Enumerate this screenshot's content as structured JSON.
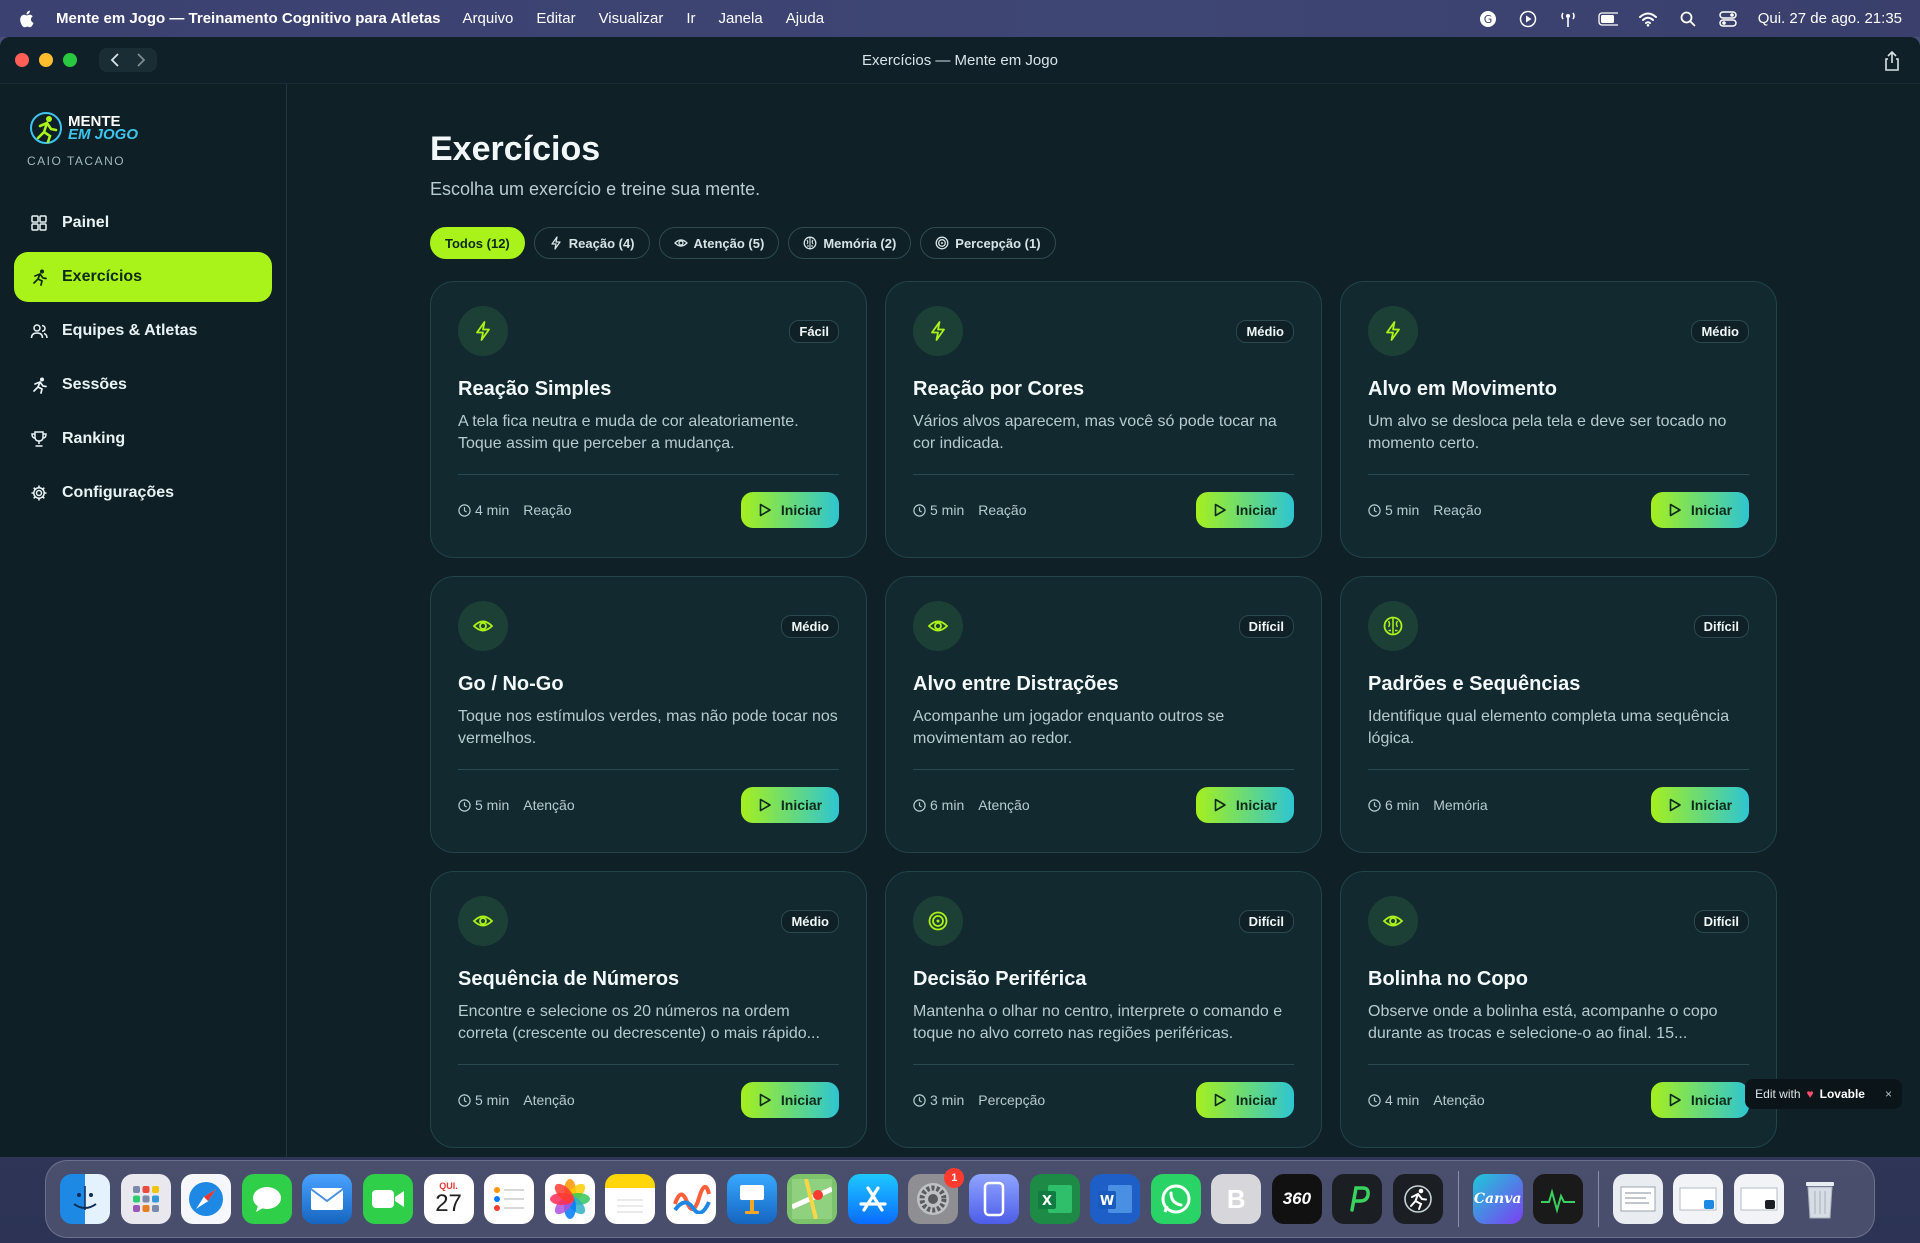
{
  "menubar": {
    "app_name": "Mente em Jogo — Treinamento Cognitivo para Atletas",
    "menus": [
      "Arquivo",
      "Editar",
      "Visualizar",
      "Ir",
      "Janela",
      "Ajuda"
    ],
    "clock": "Qui. 27 de ago.  21:35"
  },
  "window": {
    "title": "Exercícios — Mente em Jogo"
  },
  "sidebar": {
    "brand_line1": "MENTE",
    "brand_line2": "EM JOGO",
    "user": "CAIO TACANO",
    "items": [
      {
        "label": "Painel",
        "icon": "dashboard-icon"
      },
      {
        "label": "Exercícios",
        "icon": "exercises-icon",
        "active": true
      },
      {
        "label": "Equipes & Atletas",
        "icon": "users-icon"
      },
      {
        "label": "Sessões",
        "icon": "sessions-icon"
      },
      {
        "label": "Ranking",
        "icon": "trophy-icon"
      },
      {
        "label": "Configurações",
        "icon": "gear-icon"
      }
    ]
  },
  "main": {
    "title": "Exercícios",
    "subtitle": "Escolha um exercício e treine sua mente.",
    "filters": [
      {
        "label": "Todos (12)",
        "active": true
      },
      {
        "label": "Reação (4)",
        "icon": "bolt-icon"
      },
      {
        "label": "Atenção (5)",
        "icon": "eye-icon"
      },
      {
        "label": "Memória (2)",
        "icon": "brain-icon"
      },
      {
        "label": "Percepção (1)",
        "icon": "target-icon"
      }
    ],
    "start_label": "Iniciar",
    "cards": [
      {
        "title": "Reação Simples",
        "desc": "A tela fica neutra e muda de cor aleatoriamente. Toque assim que perceber a mudança.",
        "level": "Fácil",
        "time": "4 min",
        "category": "Reação",
        "icon": "bolt-icon"
      },
      {
        "title": "Reação por Cores",
        "desc": "Vários alvos aparecem, mas você só pode tocar na cor indicada.",
        "level": "Médio",
        "time": "5 min",
        "category": "Reação",
        "icon": "bolt-icon"
      },
      {
        "title": "Alvo em Movimento",
        "desc": "Um alvo se desloca pela tela e deve ser tocado no momento certo.",
        "level": "Médio",
        "time": "5 min",
        "category": "Reação",
        "icon": "bolt-icon"
      },
      {
        "title": "Go / No-Go",
        "desc": "Toque nos estímulos verdes, mas não pode tocar nos vermelhos.",
        "level": "Médio",
        "time": "5 min",
        "category": "Atenção",
        "icon": "eye-icon"
      },
      {
        "title": "Alvo entre Distrações",
        "desc": "Acompanhe um jogador enquanto outros se movimentam ao redor.",
        "level": "Difícil",
        "time": "6 min",
        "category": "Atenção",
        "icon": "eye-icon"
      },
      {
        "title": "Padrões e Sequências",
        "desc": "Identifique qual elemento completa uma sequência lógica.",
        "level": "Difícil",
        "time": "6 min",
        "category": "Memória",
        "icon": "brain-icon"
      },
      {
        "title": "Sequência de Números",
        "desc": "Encontre e selecione os 20 números na ordem correta (crescente ou decrescente) o mais rápido...",
        "level": "Médio",
        "time": "5 min",
        "category": "Atenção",
        "icon": "eye-icon"
      },
      {
        "title": "Decisão Periférica",
        "desc": "Mantenha o olhar no centro, interprete o comando e toque no alvo correto nas regiões periféricas.",
        "level": "Difícil",
        "time": "3 min",
        "category": "Percepção",
        "icon": "target-icon"
      },
      {
        "title": "Bolinha no Copo",
        "desc": "Observe onde a bolinha está, acompanhe o copo durante as trocas e selecione-o ao final. 15...",
        "level": "Difícil",
        "time": "4 min",
        "category": "Atenção",
        "icon": "eye-icon"
      }
    ]
  },
  "lovable": {
    "prefix": "Edit with",
    "brand": "Lovable",
    "close": "×"
  },
  "dock": {
    "calendar_month": "QUI.",
    "calendar_day": "27",
    "settings_badge": "1",
    "canva_label": "Canva",
    "b_label": "B",
    "label_360": "360"
  }
}
